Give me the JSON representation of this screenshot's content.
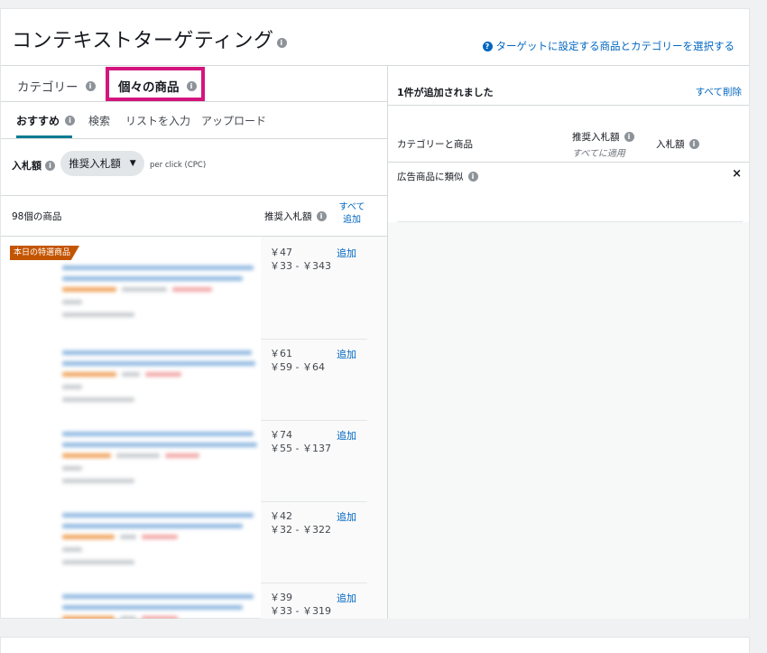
{
  "header": {
    "title": "コンテキストターゲティング",
    "help_link": "ターゲットに設定する商品とカテゴリーを選択する"
  },
  "tabs": {
    "category": "カテゴリー",
    "products": "個々の商品"
  },
  "subtabs": {
    "recommended": "おすすめ",
    "search": "検索",
    "enter_list": "リストを入力",
    "upload": "アップロード"
  },
  "bid": {
    "label": "入札額",
    "select_value": "推奨入札額",
    "per_click": "per click (CPC)"
  },
  "table": {
    "count": "98個の商品",
    "bid_header": "推奨入札額",
    "add_all": "すべて追加",
    "badge": "本日の特選商品",
    "add_label": "追加",
    "rows": [
      {
        "price": "￥47",
        "range": "￥33 - ￥343"
      },
      {
        "price": "￥61",
        "range": "￥59 - ￥64"
      },
      {
        "price": "￥74",
        "range": "￥55 - ￥137"
      },
      {
        "price": "￥42",
        "range": "￥32 - ￥322"
      },
      {
        "price": "￥39",
        "range": "￥33 - ￥319"
      }
    ]
  },
  "right": {
    "added_status": "1件が追加されました",
    "remove_all": "すべて削除",
    "col_category": "カテゴリーと商品",
    "col_suggested": "推奨入札額",
    "col_suggested_sub": "すべてに適用",
    "col_bid": "入札額",
    "row_label": "広告商品に類似",
    "close_icon": "×"
  },
  "colors": {
    "link": "#0066c0",
    "highlight": "#d4157d",
    "badge": "#c45500",
    "tab_underline": "#0a7a92"
  }
}
